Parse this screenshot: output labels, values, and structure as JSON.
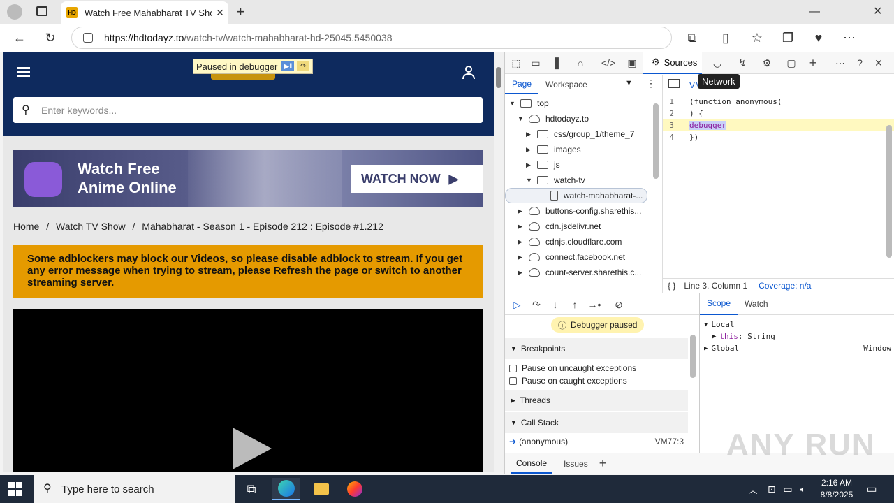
{
  "browser": {
    "tab_title": "Watch Free Mahabharat TV Show",
    "tab_favicon": "HD",
    "url_host": "https://hdtodayz.to",
    "url_path": "/watch-tv/watch-mahabharat-hd-25045.5450038"
  },
  "page": {
    "paused_label": "Paused in debugger",
    "search_placeholder": "Enter keywords...",
    "banner_line1": "Watch Free",
    "banner_line2": "Anime Online",
    "banner_button": "WATCH NOW",
    "breadcrumbs": [
      "Home",
      "/",
      "Watch TV Show",
      "/",
      "Mahabharat - Season 1 - Episode 212 : Episode #1.212"
    ],
    "alert_text": "Some adblockers may block our Videos, so please disable adblock to stream. If you get any error message when trying to stream, please Refresh the page or switch to another streaming server."
  },
  "devtools": {
    "active_tool": "Sources",
    "tooltip": "Network",
    "nav_tabs": [
      "Page",
      "Workspace"
    ],
    "editor_tab": "VM",
    "tree": [
      {
        "label": "top",
        "indent": 0,
        "arrow": "▼",
        "icon": "frame"
      },
      {
        "label": "hdtodayz.to",
        "indent": 1,
        "arrow": "▼",
        "icon": "cloud"
      },
      {
        "label": "css/group_1/theme_7",
        "indent": 2,
        "arrow": "▶",
        "icon": "folder"
      },
      {
        "label": "images",
        "indent": 2,
        "arrow": "▶",
        "icon": "folder"
      },
      {
        "label": "js",
        "indent": 2,
        "arrow": "▶",
        "icon": "folder"
      },
      {
        "label": "watch-tv",
        "indent": 2,
        "arrow": "▼",
        "icon": "folder"
      },
      {
        "label": "watch-mahabharat-...",
        "indent": 3,
        "arrow": "",
        "icon": "file"
      },
      {
        "label": "buttons-config.sharethis...",
        "indent": 1,
        "arrow": "▶",
        "icon": "cloud"
      },
      {
        "label": "cdn.jsdelivr.net",
        "indent": 1,
        "arrow": "▶",
        "icon": "cloud"
      },
      {
        "label": "cdnjs.cloudflare.com",
        "indent": 1,
        "arrow": "▶",
        "icon": "cloud"
      },
      {
        "label": "connect.facebook.net",
        "indent": 1,
        "arrow": "▶",
        "icon": "cloud"
      },
      {
        "label": "count-server.sharethis.c...",
        "indent": 1,
        "arrow": "▶",
        "icon": "cloud"
      }
    ],
    "code_lines": [
      {
        "n": "1",
        "text": "(function anonymous("
      },
      {
        "n": "2",
        "text": ") {"
      },
      {
        "n": "3",
        "text": "debugger"
      },
      {
        "n": "4",
        "text": "})"
      }
    ],
    "status_position": "Line 3, Column 1",
    "status_coverage": "Coverage: n/a",
    "debugger_paused": "Debugger paused",
    "breakpoints_label": "Breakpoints",
    "pause_uncaught": "Pause on uncaught exceptions",
    "pause_caught": "Pause on caught exceptions",
    "threads_label": "Threads",
    "callstack_label": "Call Stack",
    "callstack_fn": "(anonymous)",
    "callstack_loc": "VM77:3",
    "scope_tabs": [
      "Scope",
      "Watch"
    ],
    "scope_local": "Local",
    "scope_this_key": "this",
    "scope_this_val": ": String",
    "scope_global": "Global",
    "scope_global_val": "Window",
    "drawer_tabs": [
      "Console",
      "Issues"
    ]
  },
  "watermark": "ANY RUN",
  "taskbar": {
    "search_placeholder": "Type here to search",
    "time": "2:16 AM",
    "date": "8/8/2025"
  }
}
